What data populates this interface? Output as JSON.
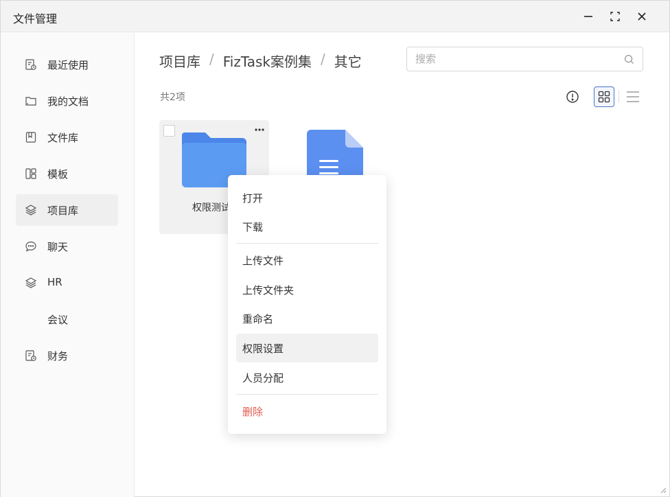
{
  "window": {
    "title": "文件管理"
  },
  "sidebar": {
    "items": [
      {
        "label": "最近使用",
        "icon": "recent-doc-icon"
      },
      {
        "label": "我的文档",
        "icon": "folder-outline-icon"
      },
      {
        "label": "文件库",
        "icon": "bookmark-book-icon"
      },
      {
        "label": "模板",
        "icon": "template-icon"
      },
      {
        "label": "项目库",
        "icon": "layers-icon"
      },
      {
        "label": "聊天",
        "icon": "chat-bubble-icon"
      },
      {
        "label": "HR",
        "icon": "layers-icon"
      },
      {
        "label": "会议",
        "icon": ""
      },
      {
        "label": "财务",
        "icon": "recent-doc-icon"
      }
    ],
    "active_index": 4
  },
  "breadcrumb": {
    "items": [
      "项目库",
      "FizTask案例集",
      "其它"
    ],
    "separator": "/"
  },
  "search": {
    "placeholder": "搜索",
    "value": ""
  },
  "summary": {
    "count_text": "共2项"
  },
  "view": {
    "mode": "grid"
  },
  "files": [
    {
      "name": "权限测试",
      "type": "folder"
    },
    {
      "name": "",
      "type": "document"
    }
  ],
  "context_menu": {
    "items_group1": [
      "打开",
      "下载"
    ],
    "items_group2": [
      "上传文件",
      "上传文件夹",
      "重命名",
      "权限设置",
      "人员分配"
    ],
    "items_group3": [
      "删除"
    ],
    "highlighted": "权限设置"
  },
  "colors": {
    "accent": "#4a74c9",
    "folder": "#5b9bf2",
    "danger": "#e25b4f"
  }
}
